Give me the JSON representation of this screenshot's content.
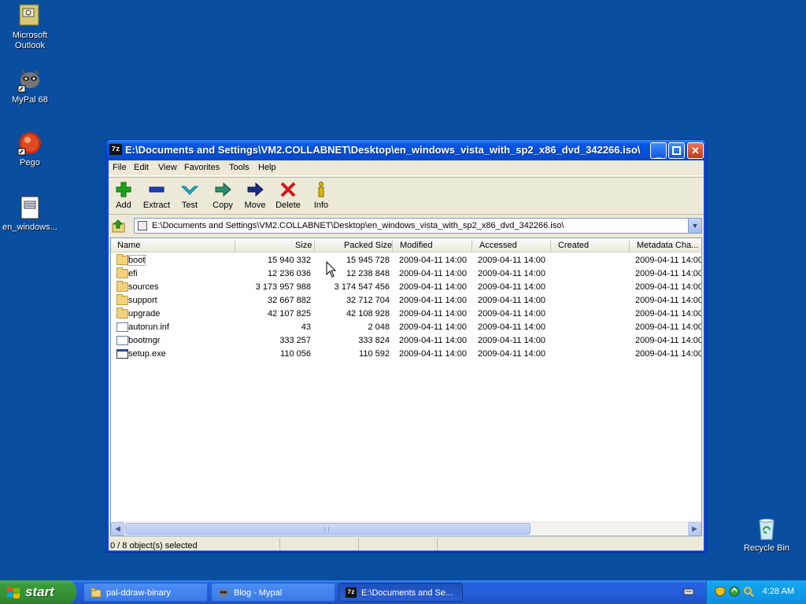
{
  "desktop": {
    "icons": [
      {
        "label": "Microsoft Outlook",
        "icon": "outlook-icon"
      },
      {
        "label": "MyPal 68",
        "icon": "raccoon-icon"
      },
      {
        "label": "Pego",
        "icon": "pego-icon"
      },
      {
        "label": "en_windows...",
        "icon": "iso-file-icon"
      },
      {
        "label": "Recycle Bin",
        "icon": "recycle-bin-icon"
      }
    ]
  },
  "window": {
    "title": "E:\\Documents and Settings\\VM2.COLLABNET\\Desktop\\en_windows_vista_with_sp2_x86_dvd_342266.iso\\",
    "app_icon_text": "7z",
    "menu": [
      "File",
      "Edit",
      "View",
      "Favorites",
      "Tools",
      "Help"
    ],
    "toolbar": [
      {
        "label": "Add",
        "icon": "plus-icon",
        "color": "#1aa31a"
      },
      {
        "label": "Extract",
        "icon": "minus-icon",
        "color": "#1a3fb8"
      },
      {
        "label": "Test",
        "icon": "check-icon",
        "color": "#22b5c8"
      },
      {
        "label": "Copy",
        "icon": "copy-arrow-icon",
        "color": "#2a8c6a"
      },
      {
        "label": "Move",
        "icon": "move-arrow-icon",
        "color": "#1a2a8a"
      },
      {
        "label": "Delete",
        "icon": "delete-x-icon",
        "color": "#d01818"
      },
      {
        "label": "Info",
        "icon": "info-icon",
        "color": "#d8b800"
      }
    ],
    "address": "E:\\Documents and Settings\\VM2.COLLABNET\\Desktop\\en_windows_vista_with_sp2_x86_dvd_342266.iso\\",
    "columns": [
      "Name",
      "Size",
      "Packed Size",
      "Modified",
      "Accessed",
      "Created",
      "Metadata Cha..."
    ],
    "rows": [
      {
        "name": "boot",
        "type": "folder",
        "size": "15 940 332",
        "packed": "15 945 728",
        "modified": "2009-04-11 14:00",
        "accessed": "2009-04-11 14:00",
        "created": "",
        "meta": "2009-04-11 14:00"
      },
      {
        "name": "efi",
        "type": "folder",
        "size": "12 236 036",
        "packed": "12 238 848",
        "modified": "2009-04-11 14:00",
        "accessed": "2009-04-11 14:00",
        "created": "",
        "meta": "2009-04-11 14:00"
      },
      {
        "name": "sources",
        "type": "folder",
        "size": "3 173 957 988",
        "packed": "3 174 547 456",
        "modified": "2009-04-11 14:00",
        "accessed": "2009-04-11 14:00",
        "created": "",
        "meta": "2009-04-11 14:00"
      },
      {
        "name": "support",
        "type": "folder",
        "size": "32 667 882",
        "packed": "32 712 704",
        "modified": "2009-04-11 14:00",
        "accessed": "2009-04-11 14:00",
        "created": "",
        "meta": "2009-04-11 14:00"
      },
      {
        "name": "upgrade",
        "type": "folder",
        "size": "42 107 825",
        "packed": "42 108 928",
        "modified": "2009-04-11 14:00",
        "accessed": "2009-04-11 14:00",
        "created": "",
        "meta": "2009-04-11 14:00"
      },
      {
        "name": "autorun.inf",
        "type": "file",
        "size": "43",
        "packed": "2 048",
        "modified": "2009-04-11 14:00",
        "accessed": "2009-04-11 14:00",
        "created": "",
        "meta": "2009-04-11 14:00"
      },
      {
        "name": "bootmgr",
        "type": "file",
        "size": "333 257",
        "packed": "333 824",
        "modified": "2009-04-11 14:00",
        "accessed": "2009-04-11 14:00",
        "created": "",
        "meta": "2009-04-11 14:00"
      },
      {
        "name": "setup.exe",
        "type": "exe",
        "size": "110 056",
        "packed": "110 592",
        "modified": "2009-04-11 14:00",
        "accessed": "2009-04-11 14:00",
        "created": "",
        "meta": "2009-04-11 14:00"
      }
    ],
    "status": "0 / 8 object(s) selected"
  },
  "taskbar": {
    "start_label": "start",
    "tasks": [
      {
        "label": "pal-ddraw-binary",
        "icon": "folder-icon",
        "active": false
      },
      {
        "label": "Blog - Mypal",
        "icon": "raccoon-icon",
        "active": false
      },
      {
        "label": "E:\\Documents and Se...",
        "icon": "7zip-icon",
        "active": true
      }
    ],
    "clock": "4:28 AM"
  }
}
